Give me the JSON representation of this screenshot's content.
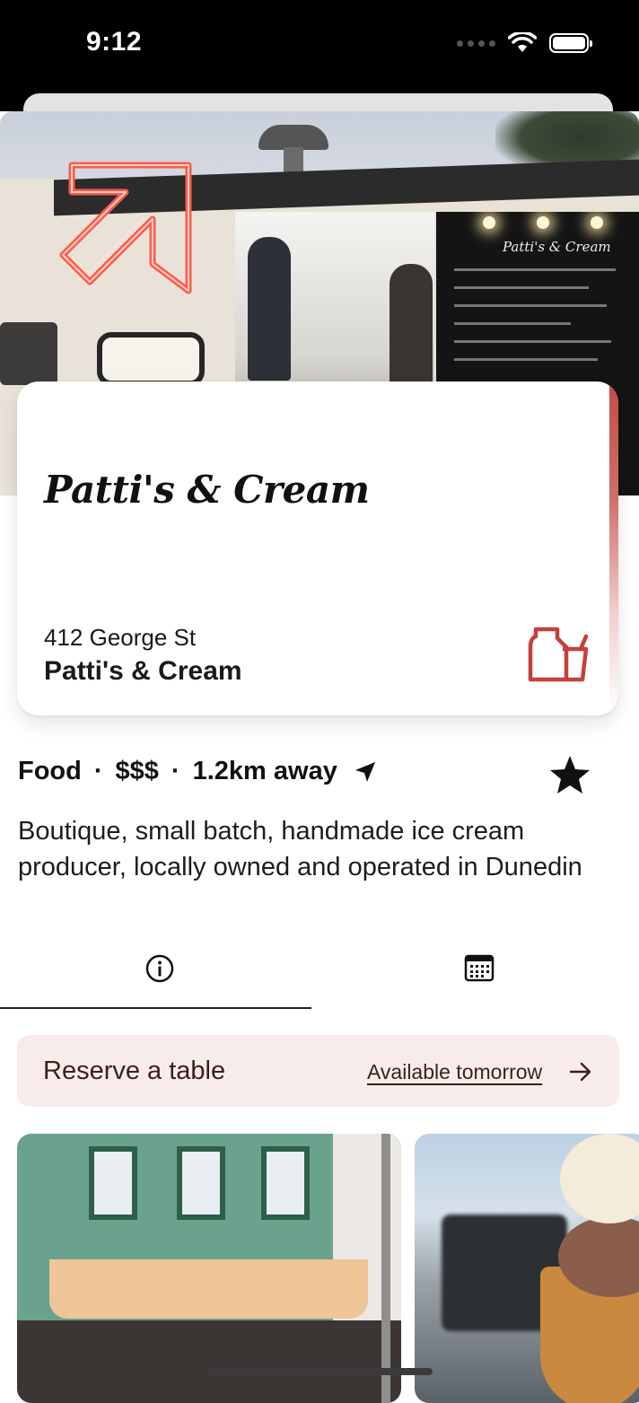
{
  "status_bar": {
    "time": "9:12"
  },
  "hero": {
    "image_alt": "Food truck with neon arrow sign"
  },
  "card": {
    "logo_text": "Patti's & Cream",
    "address": "412 George St",
    "name": "Patti's & Cream",
    "icon": "takeaway-icon"
  },
  "meta": {
    "category": "Food",
    "price": "$$$",
    "distance": "1.2km away",
    "favorite_icon": "star-icon"
  },
  "description": "Boutique, small batch, handmade ice cream producer, locally owned and operated in Dunedin",
  "tabs": [
    {
      "icon": "info-icon",
      "selected": true
    },
    {
      "icon": "calendar-icon",
      "selected": false
    }
  ],
  "reserve": {
    "label": "Reserve a table",
    "availability": "Available tomorrow"
  },
  "photos": [
    {
      "subject": "storefront"
    },
    {
      "subject": "ice cream cone"
    }
  ],
  "colors": {
    "accent": "#c6403a",
    "reserve_bg": "#f8ecea",
    "text": "#111111"
  }
}
